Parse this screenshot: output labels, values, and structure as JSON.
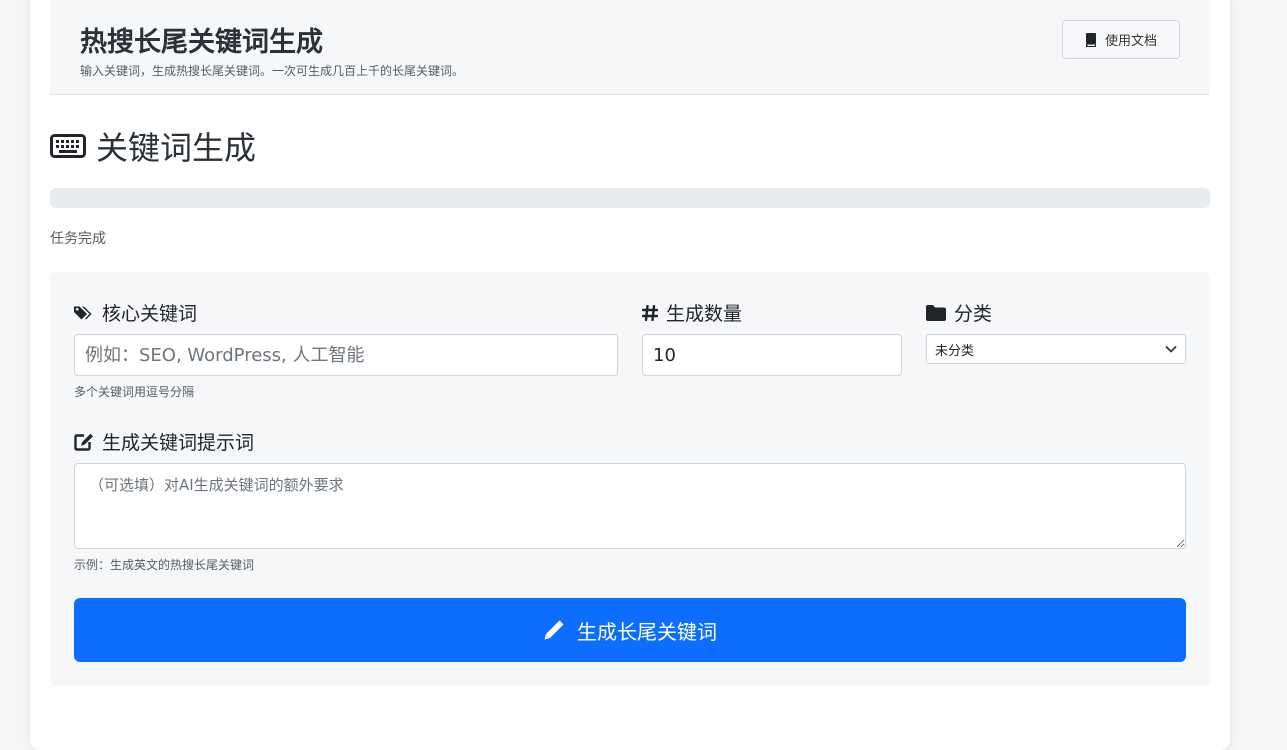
{
  "header": {
    "title": "热搜长尾关键词生成",
    "subtitle": "输入关键词，生成热搜长尾关键词。一次可生成几百上千的长尾关键词。",
    "doc_button": "使用文档"
  },
  "section": {
    "title": "关键词生成",
    "icon": "keyboard-icon"
  },
  "progress": {
    "value": 0
  },
  "status": "任务完成",
  "form": {
    "keywords": {
      "label": "核心关键词",
      "icon": "tags-icon",
      "placeholder": "例如：SEO, WordPress, 人工智能",
      "value": "",
      "hint": "多个关键词用逗号分隔"
    },
    "count": {
      "label": "生成数量",
      "icon": "hashtag-icon",
      "value": "10"
    },
    "category": {
      "label": "分类",
      "icon": "folder-icon",
      "selected": "未分类"
    },
    "prompt": {
      "label": "生成关键词提示词",
      "icon": "edit-icon",
      "placeholder": "（可选填）对AI生成关键词的额外要求",
      "hint": "示例：生成英文的热搜长尾关键词"
    },
    "submit": {
      "label": "生成长尾关键词",
      "icon": "pencil-icon"
    }
  },
  "colors": {
    "primary": "#0d6efd",
    "panel": "#f6f7f9",
    "progress_track": "#e9ecef"
  }
}
